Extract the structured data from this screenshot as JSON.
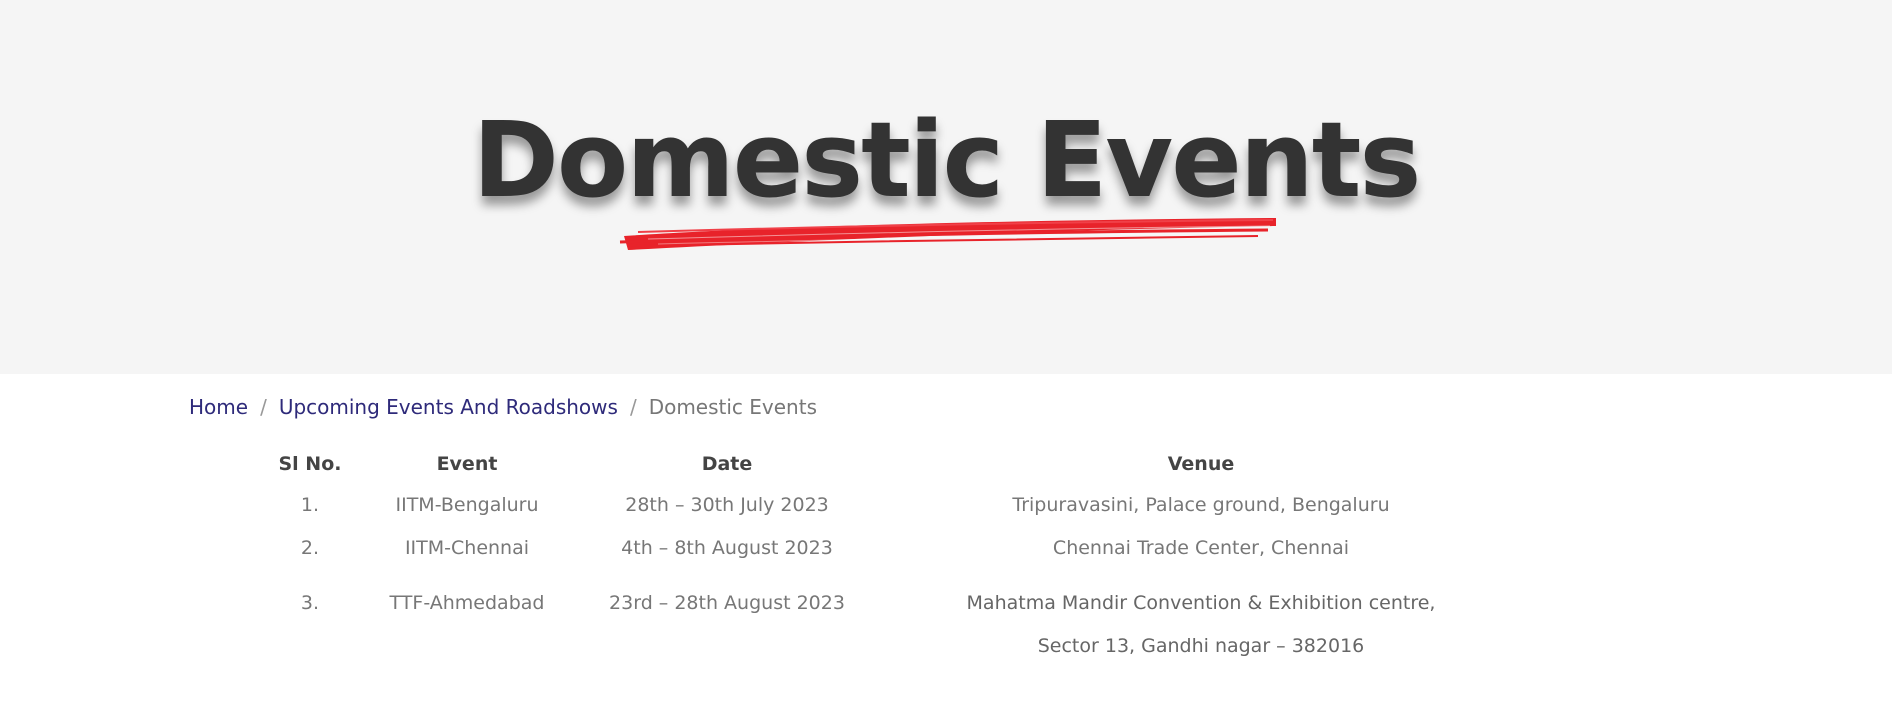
{
  "hero": {
    "title": "Domestic Events",
    "underline_color": "#e8232a",
    "background": "#f5f5f5"
  },
  "breadcrumb": {
    "home": "Home",
    "separator": "/",
    "parent": "Upcoming Events And Roadshows",
    "current": "Domestic Events",
    "link_color": "#2e2a7a"
  },
  "table": {
    "headers": {
      "sl_no": "Sl No.",
      "event": "Event",
      "date": "Date",
      "venue": "Venue"
    },
    "rows": [
      {
        "sl_no": "1.",
        "event": "IITM-Bengaluru",
        "date": "28th – 30th July 2023",
        "venue_line1": "Tripuravasini, Palace ground, Bengaluru",
        "venue_line2": ""
      },
      {
        "sl_no": "2.",
        "event": "IITM-Chennai",
        "date": "4th – 8th August 2023",
        "venue_line1": "Chennai Trade Center, Chennai",
        "venue_line2": ""
      },
      {
        "sl_no": "3.",
        "event": "TTF-Ahmedabad",
        "date": "23rd – 28th August 2023",
        "venue_line1": "Mahatma Mandir Convention & Exhibition centre,",
        "venue_line2": "Sector 13, Gandhi nagar – 382016"
      }
    ]
  }
}
